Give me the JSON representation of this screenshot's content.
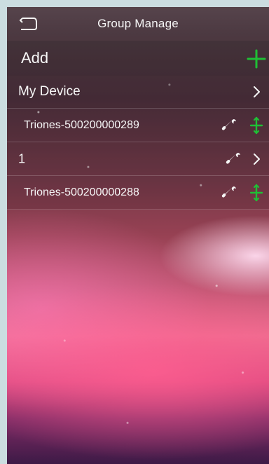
{
  "header": {
    "title": "Group Manage",
    "back_icon": "back-icon"
  },
  "rows": {
    "add": {
      "label": "Add",
      "icon": "plus-icon"
    },
    "my_device": {
      "label": "My Device",
      "icon": "chevron-right-icon"
    },
    "device_1": {
      "label": "Triones-500200000289",
      "edit_icon": "wrench-icon",
      "move_icon": "move-icon"
    },
    "group_1": {
      "label": "1",
      "edit_icon": "wrench-icon",
      "nav_icon": "chevron-right-icon"
    },
    "device_2": {
      "label": "Triones-500200000288",
      "edit_icon": "wrench-icon",
      "move_icon": "move-icon"
    }
  },
  "colors": {
    "accent_green": "#1fbf35",
    "text_light": "#f7f7f7"
  }
}
